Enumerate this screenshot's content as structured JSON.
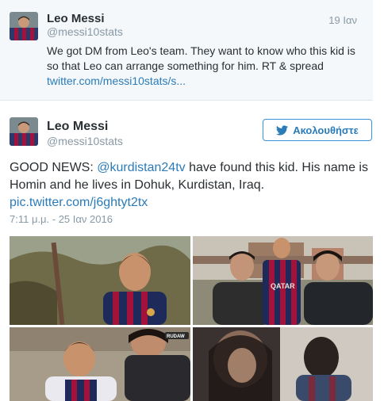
{
  "quoted_tweet": {
    "name": "Leo Messi",
    "handle": "@messi10stats",
    "date": "19 Ιαν",
    "text": "We got DM from Leo's team. They want to know who this kid is so that Leo can arrange something for him. RT & spread",
    "link": "twitter.com/messi10stats/s..."
  },
  "main_tweet": {
    "name": "Leo Messi",
    "handle": "@messi10stats",
    "follow_label": "Ακολουθήστε",
    "text_prefix": "GOOD NEWS: ",
    "mention": "@kurdistan24tv",
    "text_suffix": " have found this kid. His name is Homin and he lives in Dohuk, Kurdistan, Iraq.",
    "pic_link": "pic.twitter.com/j6ghtyt2tx",
    "timestamp": "7:11 μ.μ. - 25 Ιαν 2016",
    "jersey_text": "QATAR",
    "photo_badge": "RUDAW"
  },
  "icons": [
    "twitter-bird-icon"
  ],
  "colors": {
    "link": "#2b7bb9",
    "muted": "#8899a6",
    "text": "#292f33",
    "quoted_bg": "#f5f8fa",
    "follow_border": "#3b94d9"
  }
}
